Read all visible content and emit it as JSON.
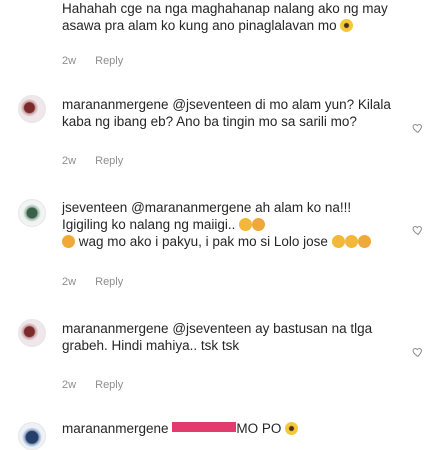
{
  "comments": [
    {
      "user": "",
      "text": "Hahahah cge na nga maghahanap nalang ako ng may asawa pra alam ko kung ano pinaglalavan mo",
      "time": "2w",
      "reply_label": "Reply"
    },
    {
      "user": "marananmergene",
      "text": "@jseventeen di mo alam yun? Kilala kaba ng ibang eb? Ano ba tingin mo sa sarili mo?",
      "time": "2w",
      "reply_label": "Reply"
    },
    {
      "user": "jseventeen",
      "text": "@marananmergene ah alam ko na!!! Igigiling ko nalang ng maiigi..",
      "text2": "wag mo ako i pakyu, i pak mo si Lolo jose",
      "time": "2w",
      "reply_label": "Reply"
    },
    {
      "user": "marananmergene",
      "text": "@jseventeen ay bastusan na tlga grabeh. Hindi mahiya.. tsk tsk",
      "time": "2w",
      "reply_label": "Reply"
    },
    {
      "user": "marananmergene",
      "text": "MO PO"
    }
  ],
  "colors": {
    "text": "#262626",
    "meta": "#8e8e8e",
    "highlight": "#e23b6d"
  }
}
